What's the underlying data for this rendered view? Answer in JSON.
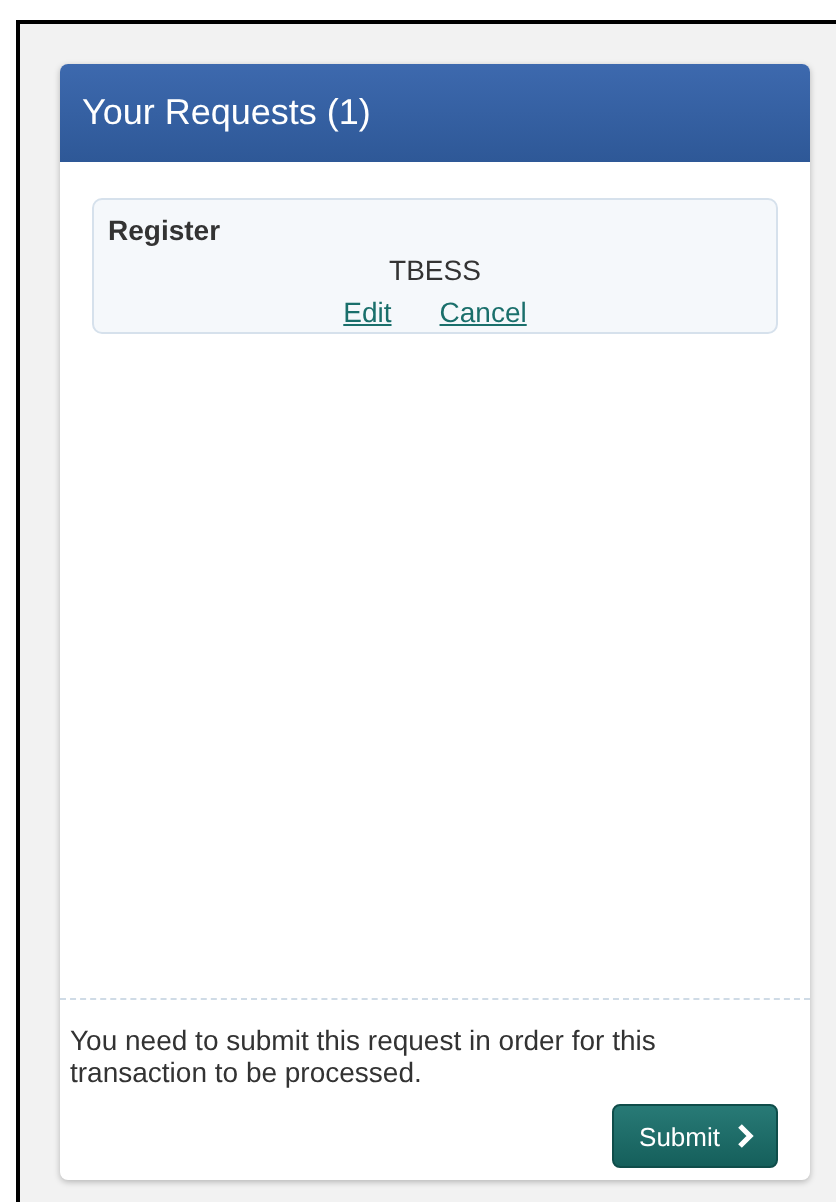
{
  "panel": {
    "title": "Your Requests (1)"
  },
  "requests": [
    {
      "type": "Register",
      "code": "TBESS",
      "actions": [
        {
          "label": "Edit"
        },
        {
          "label": "Cancel"
        }
      ]
    }
  ],
  "footer": {
    "message": "You need to submit this request in order for this transaction to be processed.",
    "button": "Submit"
  }
}
